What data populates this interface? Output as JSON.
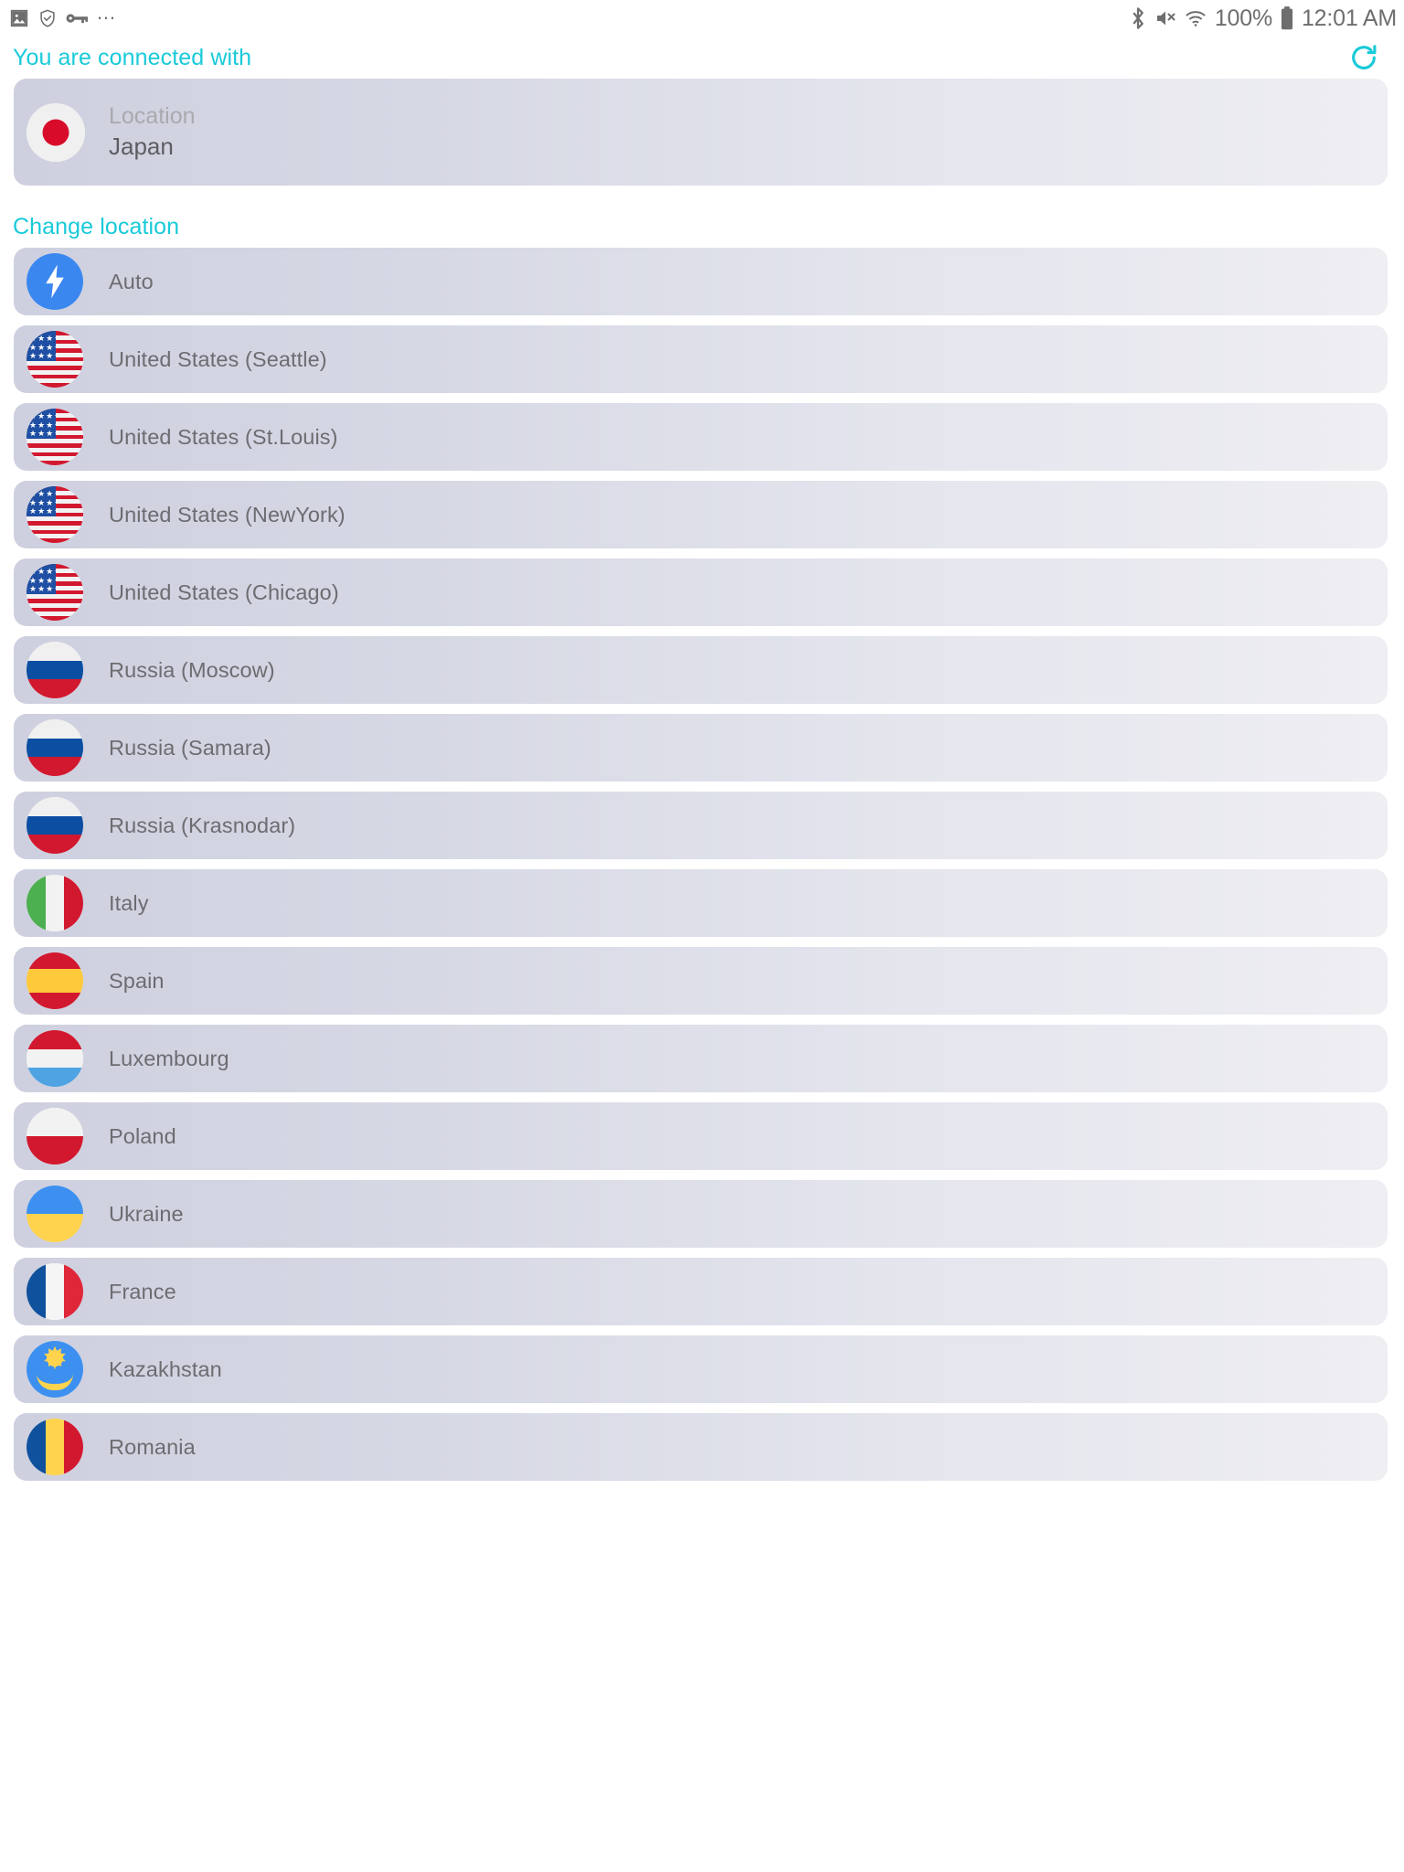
{
  "statusbar": {
    "left_icons": [
      "image-icon",
      "shield-check-icon",
      "key-icon",
      "more-dots-icon"
    ],
    "right_icons": [
      "bluetooth-icon",
      "mute-icon",
      "wifi-icon",
      "battery-icon"
    ],
    "battery_percent": "100%",
    "time": "12:01 AM"
  },
  "connected": {
    "header": "You are connected with",
    "refresh_icon": "refresh-icon",
    "location_label": "Location",
    "location_value": "Japan",
    "flag": "jp"
  },
  "change_location": {
    "header": "Change location"
  },
  "locations": [
    {
      "label": "Auto",
      "flag": "auto"
    },
    {
      "label": "United States (Seattle)",
      "flag": "us"
    },
    {
      "label": "United States (St.Louis)",
      "flag": "us"
    },
    {
      "label": "United States (NewYork)",
      "flag": "us"
    },
    {
      "label": "United States (Chicago)",
      "flag": "us"
    },
    {
      "label": "Russia (Moscow)",
      "flag": "ru"
    },
    {
      "label": "Russia (Samara)",
      "flag": "ru"
    },
    {
      "label": "Russia (Krasnodar)",
      "flag": "ru"
    },
    {
      "label": "Italy",
      "flag": "it"
    },
    {
      "label": "Spain",
      "flag": "es"
    },
    {
      "label": "Luxembourg",
      "flag": "lu"
    },
    {
      "label": "Poland",
      "flag": "pl"
    },
    {
      "label": "Ukraine",
      "flag": "ua"
    },
    {
      "label": "France",
      "flag": "fr"
    },
    {
      "label": "Kazakhstan",
      "flag": "kz"
    },
    {
      "label": "Romania",
      "flag": "ro"
    }
  ],
  "colors": {
    "accent": "#19cad9",
    "card_start": "#ced0df",
    "card_end": "#eeeef3",
    "label_text": "#6c6c71",
    "muted_text": "#a9a9ae",
    "status_icon": "#6e6e6e",
    "auto_blue": "#3b87f0"
  }
}
